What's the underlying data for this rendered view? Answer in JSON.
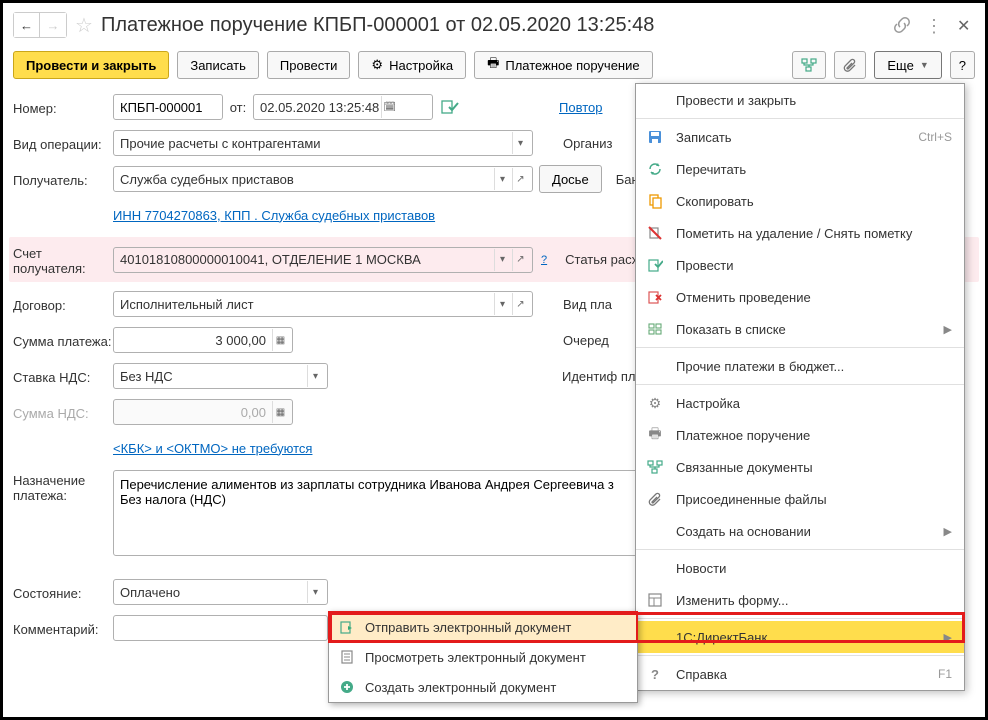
{
  "title": "Платежное поручение КПБП-000001 от 02.05.2020 13:25:48",
  "toolbar": {
    "post_close": "Провести и закрыть",
    "save": "Записать",
    "post": "Провести",
    "settings": "Настройка",
    "print": "Платежное поручение",
    "more": "Еще",
    "help": "?"
  },
  "labels": {
    "number": "Номер:",
    "from": "от:",
    "op_type": "Вид операции:",
    "recipient": "Получатель:",
    "dossier": "Досье",
    "recip_account": "Счет получателя:",
    "contract": "Договор:",
    "amount": "Сумма платежа:",
    "vat_rate": "Ставка НДС:",
    "vat_amount": "Сумма НДС:",
    "purpose": "Назначение платежа:",
    "status": "Состояние:",
    "comment": "Комментарий:",
    "repeat": "Повтор",
    "org": "Организ",
    "bank_acc": "Банков счет:",
    "inn77": "ИНН 77",
    "dds": "Статья расход",
    "pay_type": "Вид пла",
    "order": "Очеред",
    "ident": "Идентиф платежа"
  },
  "values": {
    "number": "КПБП-000001",
    "date": "02.05.2020 13:25:48",
    "op_type": "Прочие расчеты с контрагентами",
    "recipient": "Служба судебных приставов",
    "inn_link": "ИНН 7704270863, КПП . Служба судебных приставов",
    "recip_account": "40101810800000010041, ОТДЕЛЕНИЕ 1 МОСКВА",
    "contract": "Исполнительный лист",
    "amount": "3 000,00",
    "vat_rate": "Без НДС",
    "vat_amount": "0,00",
    "kbk_link": "<КБК> и <ОКТМО> не требуются",
    "purpose": "Перечисление алиментов из зарплаты сотрудника Иванова Андрея Сергеевича з\nБез налога (НДС)",
    "status": "Оплачено"
  },
  "small_menu": [
    {
      "label": "Отправить электронный документ",
      "hl": true,
      "icon": "send"
    },
    {
      "label": "Просмотреть электронный документ",
      "hl": false,
      "icon": "view"
    },
    {
      "label": "Создать электронный документ",
      "hl": false,
      "icon": "add"
    }
  ],
  "more_menu": [
    {
      "label": "Провести и закрыть",
      "icon": "",
      "type": "item"
    },
    {
      "label": "Записать",
      "icon": "save",
      "shortcut": "Ctrl+S",
      "type": "item"
    },
    {
      "label": "Перечитать",
      "icon": "refresh",
      "type": "item"
    },
    {
      "label": "Скопировать",
      "icon": "copy",
      "type": "item"
    },
    {
      "label": "Пометить на удаление / Снять пометку",
      "icon": "delete",
      "type": "item"
    },
    {
      "label": "Провести",
      "icon": "post",
      "type": "item"
    },
    {
      "label": "Отменить проведение",
      "icon": "unpost",
      "type": "item"
    },
    {
      "label": "Показать в списке",
      "icon": "list",
      "submenu": true,
      "type": "item"
    },
    {
      "label": "Прочие платежи в бюджет...",
      "icon": "",
      "type": "item"
    },
    {
      "label": "Настройка",
      "icon": "gear",
      "type": "item"
    },
    {
      "label": "Платежное поручение",
      "icon": "print",
      "type": "item"
    },
    {
      "label": "Связанные документы",
      "icon": "linked",
      "type": "item"
    },
    {
      "label": "Присоединенные файлы",
      "icon": "attach",
      "type": "item"
    },
    {
      "label": "Создать на основании",
      "icon": "",
      "submenu": true,
      "type": "item"
    },
    {
      "label": "Новости",
      "icon": "",
      "type": "item"
    },
    {
      "label": "Изменить форму...",
      "icon": "form",
      "type": "item"
    },
    {
      "label": "1С:ДиректБанк",
      "icon": "",
      "submenu": true,
      "hl": true,
      "type": "item"
    },
    {
      "label": "Справка",
      "icon": "help",
      "shortcut": "F1",
      "type": "item"
    }
  ]
}
